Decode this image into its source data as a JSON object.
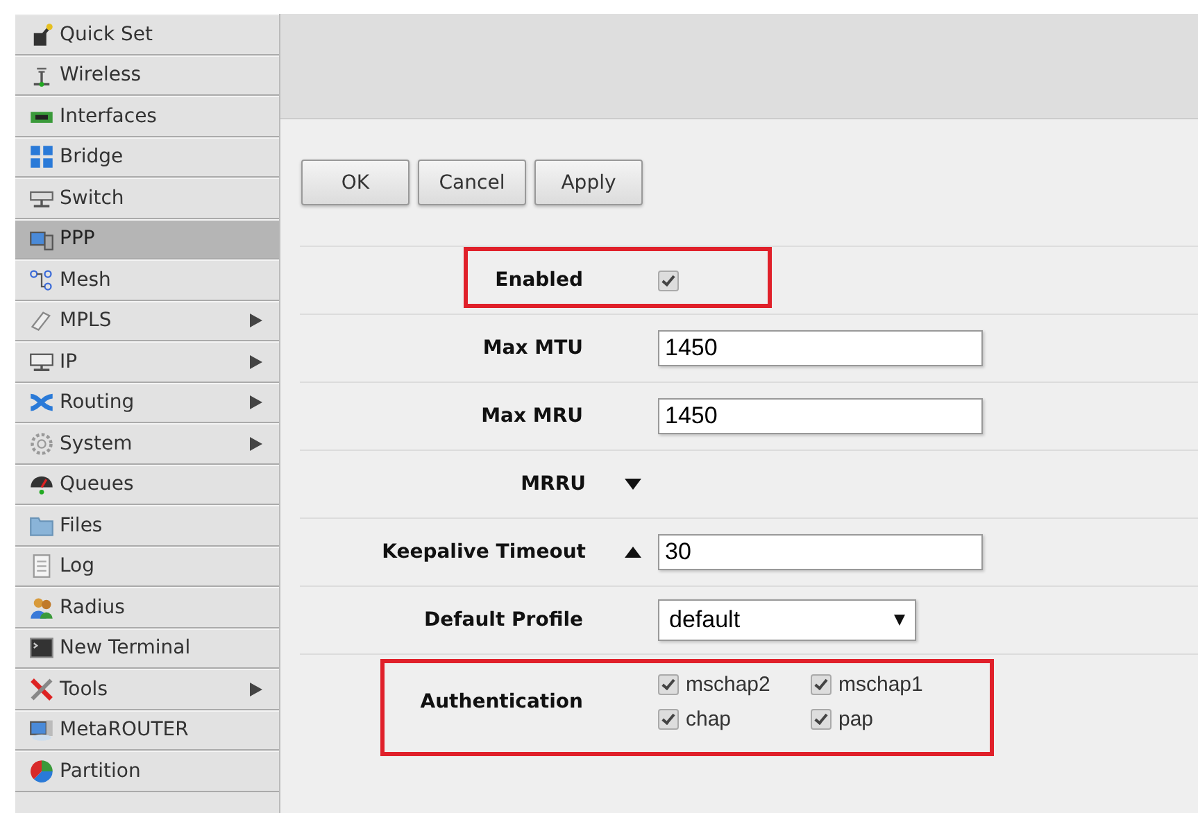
{
  "sidebar": {
    "items": [
      {
        "label": "Quick Set",
        "selected": false,
        "submenu": false
      },
      {
        "label": "Wireless",
        "selected": false,
        "submenu": false
      },
      {
        "label": "Interfaces",
        "selected": false,
        "submenu": false
      },
      {
        "label": "Bridge",
        "selected": false,
        "submenu": false
      },
      {
        "label": "Switch",
        "selected": false,
        "submenu": false
      },
      {
        "label": "PPP",
        "selected": true,
        "submenu": false
      },
      {
        "label": "Mesh",
        "selected": false,
        "submenu": false
      },
      {
        "label": "MPLS",
        "selected": false,
        "submenu": true
      },
      {
        "label": "IP",
        "selected": false,
        "submenu": true
      },
      {
        "label": "Routing",
        "selected": false,
        "submenu": true
      },
      {
        "label": "System",
        "selected": false,
        "submenu": true
      },
      {
        "label": "Queues",
        "selected": false,
        "submenu": false
      },
      {
        "label": "Files",
        "selected": false,
        "submenu": false
      },
      {
        "label": "Log",
        "selected": false,
        "submenu": false
      },
      {
        "label": "Radius",
        "selected": false,
        "submenu": false
      },
      {
        "label": "New Terminal",
        "selected": false,
        "submenu": false
      },
      {
        "label": "Tools",
        "selected": false,
        "submenu": true
      },
      {
        "label": "MetaROUTER",
        "selected": false,
        "submenu": false
      },
      {
        "label": "Partition",
        "selected": false,
        "submenu": false
      }
    ]
  },
  "buttons": [
    "OK",
    "Cancel",
    "Apply"
  ],
  "form": {
    "rows": [
      {
        "kind": "checkbox",
        "label": "Enabled",
        "checked": true,
        "highlighted": true
      },
      {
        "kind": "text",
        "label": "Max MTU",
        "value": "1450",
        "highlighted": false
      },
      {
        "kind": "text",
        "label": "Max MRU",
        "value": "1450",
        "highlighted": false
      },
      {
        "kind": "toggle",
        "label": "MRRU",
        "expanded": false,
        "highlighted": false
      },
      {
        "kind": "toggle-text",
        "label": "Keepalive Timeout",
        "expanded": true,
        "value": "30",
        "highlighted": false
      },
      {
        "kind": "select",
        "label": "Default Profile",
        "value": "default",
        "highlighted": false
      },
      {
        "kind": "checkgroup",
        "label": "Authentication",
        "highlighted": true,
        "options": [
          {
            "label": "mschap2",
            "checked": true
          },
          {
            "label": "mschap1",
            "checked": true
          },
          {
            "label": "chap",
            "checked": true
          },
          {
            "label": "pap",
            "checked": true
          }
        ]
      }
    ]
  }
}
